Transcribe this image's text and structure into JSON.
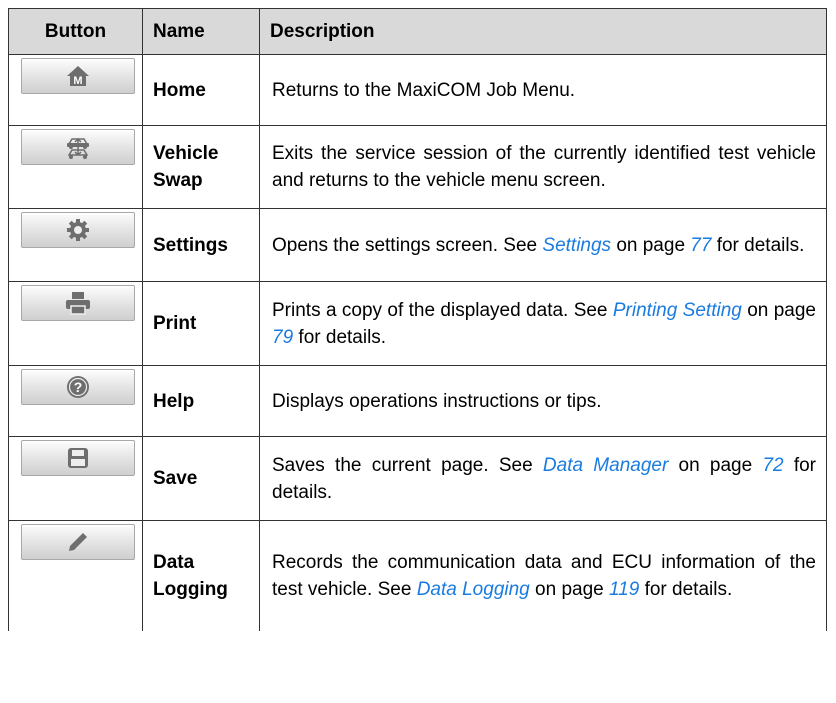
{
  "table": {
    "headers": {
      "button": "Button",
      "name": "Name",
      "description": "Description"
    },
    "rows": [
      {
        "icon": "home-icon",
        "name": "Home",
        "desc_before": "Returns to the MaxiCOM Job Menu.",
        "link1": "",
        "desc_mid": "",
        "link2": "",
        "desc_after": ""
      },
      {
        "icon": "vehicle-swap-icon",
        "name": "Vehicle Swap",
        "desc_before": "Exits the service session of the currently identified test vehicle and returns to the vehicle menu screen.",
        "link1": "",
        "desc_mid": "",
        "link2": "",
        "desc_after": ""
      },
      {
        "icon": "gear-icon",
        "name": "Settings",
        "desc_before": "Opens the settings screen. See ",
        "link1": "Settings",
        "desc_mid": " on page ",
        "link2": "77",
        "desc_after": " for details."
      },
      {
        "icon": "printer-icon",
        "name": "Print",
        "desc_before": "Prints a copy of the displayed data. See ",
        "link1": "Printing Setting",
        "desc_mid": " on page ",
        "link2": "79",
        "desc_after": " for details."
      },
      {
        "icon": "help-icon",
        "name": "Help",
        "desc_before": "Displays operations instructions or tips.",
        "link1": "",
        "desc_mid": "",
        "link2": "",
        "desc_after": ""
      },
      {
        "icon": "floppy-disk-icon",
        "name": "Save",
        "desc_before": "Saves the current page. See ",
        "link1": "Data Manager",
        "desc_mid": " on page ",
        "link2": "72",
        "desc_after": " for details."
      },
      {
        "icon": "pencil-icon",
        "name": "Data Logging",
        "desc_before": "Records the communication data and ECU information of the test vehicle. See ",
        "link1": "Data Logging",
        "desc_mid": " on page ",
        "link2": "119",
        "desc_after": " for details."
      }
    ]
  },
  "colors": {
    "link": "#1a7be0",
    "header_bg": "#d9d9d9",
    "icon_gray": "#6e6e6e"
  }
}
